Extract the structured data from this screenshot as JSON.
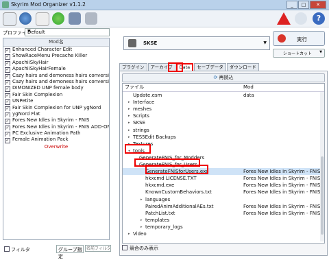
{
  "window": {
    "title": "Skyrim Mod Organizer v1.1.2"
  },
  "left": {
    "profile_label": "プロファイル",
    "profile_value": "Default",
    "modlist_header": "Mod名",
    "mods": [
      "Enhanced Character Edit",
      "ShowRaceMenu Precache Killer",
      "ApachiiSkyHair",
      "ApachiiSkyHairFemale",
      "Cazy hairs and demoness hairs conversion b...",
      "Cazy hairs and demoness hairs conversion b...",
      "DIMONIZED UNP female body",
      "Fair Skin Complexion",
      "UNPetite",
      "Fair Skin Complexion for UNP ygNord",
      "ygNord Flat",
      "Fores New Idles in Skyrim - FNIS",
      "Fores New Idles in Skyrim - FNIS ADD-ON",
      "PC Exclusive Animation Path",
      "Female Animation Pack"
    ],
    "overwrite": "Overwrite",
    "filter_label": "フィルタ",
    "group_label": "グループ指定",
    "name_filter_placeholder": "名前フィルタ"
  },
  "right": {
    "executable": "SKSE",
    "run_label": "実行",
    "shortcut_label": "ショートカット",
    "tabs": [
      "プラグイン",
      "アーカイブ",
      "Data",
      "セーブデータ",
      "ダウンロード"
    ],
    "active_tab": "Data",
    "refresh_label": "再読込",
    "col_file": "ファイル",
    "col_mod": "Mod",
    "tree": [
      {
        "name": "Update.esm",
        "mod": "data"
      },
      {
        "name": "Interface",
        "mod": ""
      },
      {
        "name": "meshes",
        "mod": ""
      },
      {
        "name": "Scripts",
        "mod": ""
      },
      {
        "name": "SKSE",
        "mod": ""
      },
      {
        "name": "strings",
        "mod": ""
      },
      {
        "name": "TES5Edit Backups",
        "mod": ""
      },
      {
        "name": "Textures",
        "mod": ""
      },
      {
        "name": "tools",
        "mod": ""
      },
      {
        "name": "GenerateFNIS_for_Modders",
        "mod": ""
      },
      {
        "name": "GenerateFNIS_for_Users",
        "mod": ""
      },
      {
        "name": "GenerateFNISforUsers.exe",
        "mod": "Fores New Idles in Skyrim - FNIS"
      },
      {
        "name": "hkxcmd LICENSE.TXT",
        "mod": "Fores New Idles in Skyrim - FNIS"
      },
      {
        "name": "hkxcmd.exe",
        "mod": "Fores New Idles in Skyrim - FNIS"
      },
      {
        "name": "KnownCustomBehaviors.txt",
        "mod": "Fores New Idles in Skyrim - FNIS"
      },
      {
        "name": "languages",
        "mod": ""
      },
      {
        "name": "PairedAnimAdditionalAEs.txt",
        "mod": "Fores New Idles in Skyrim - FNIS"
      },
      {
        "name": "PatchList.txt",
        "mod": "Fores New Idles in Skyrim - FNIS"
      },
      {
        "name": "templates",
        "mod": ""
      },
      {
        "name": "temporary_logs",
        "mod": ""
      },
      {
        "name": "Video",
        "mod": ""
      }
    ],
    "conflict_only_label": "競合のみ表示"
  },
  "colors": {
    "highlight": "#e00000",
    "accent": "#2a6fb0"
  },
  "icons": [
    "profile-icon",
    "nexus-icon",
    "ini-icon",
    "settings-icon",
    "tools-icon",
    "warning-icon",
    "update-icon",
    "help-icon"
  ]
}
